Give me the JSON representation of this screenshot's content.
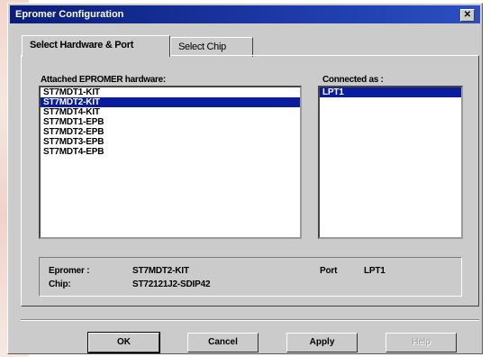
{
  "window": {
    "title": "Epromer Configuration",
    "close_glyph": "✕"
  },
  "tabs": [
    {
      "label": "Select Hardware & Port",
      "active": true
    },
    {
      "label": "Select Chip",
      "active": false
    }
  ],
  "hardware": {
    "label": "Attached EPROMER hardware:",
    "items": [
      "ST7MDT1-KIT",
      "ST7MDT2-KIT",
      "ST7MDT4-KIT",
      "ST7MDT1-EPB",
      "ST7MDT2-EPB",
      "ST7MDT3-EPB",
      "ST7MDT4-EPB"
    ],
    "selected": "ST7MDT2-KIT"
  },
  "connection": {
    "label": "Connected as :",
    "items": [
      "LPT1"
    ],
    "selected": "LPT1"
  },
  "summary": {
    "epromer_label": "Epromer :",
    "epromer_value": "ST7MDT2-KIT",
    "port_label": "Port",
    "port_value": "LPT1",
    "chip_label": "Chip:",
    "chip_value": "ST72121J2-SDIP42"
  },
  "buttons": {
    "ok": "OK",
    "cancel": "Cancel",
    "apply": "Apply",
    "help": "Help"
  },
  "colors": {
    "title_bar": "#0a1d7c",
    "selection": "#0a1d9c",
    "dialog_bg": "#cbcbcb"
  }
}
